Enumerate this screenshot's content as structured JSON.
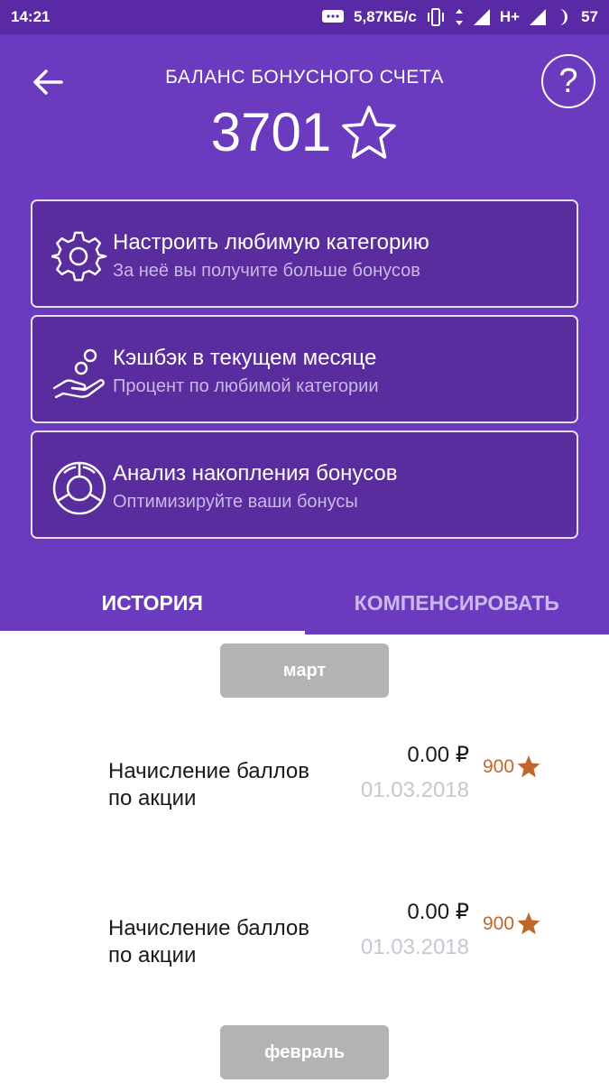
{
  "status_bar": {
    "time": "14:21",
    "speed": "5,87КБ/с",
    "network": "H+",
    "battery": "57",
    "icons": [
      "message-icon",
      "vibrate-icon",
      "data-arrows-icon",
      "signal-icon",
      "signal-icon",
      "moon-icon"
    ]
  },
  "header": {
    "back_icon": "arrow-left-icon",
    "help_label": "?",
    "title": "БАЛАНС БОНУСНОГО СЧЕТА",
    "balance": "3701",
    "balance_icon": "star-outline-icon"
  },
  "cards": [
    {
      "icon": "gear-icon",
      "title": "Настроить любимую категорию",
      "subtitle": "За неё вы получите больше бонусов"
    },
    {
      "icon": "hand-coins-icon",
      "title": "Кэшбэк в текущем месяце",
      "subtitle": "Процент по любимой категории"
    },
    {
      "icon": "pie-segments-icon",
      "title": "Анализ накопления бонусов",
      "subtitle": "Оптимизируйте ваши бонусы"
    }
  ],
  "tabs": [
    {
      "label": "ИСТОРИЯ",
      "active": true
    },
    {
      "label": "КОМПЕНСИРОВАТЬ",
      "active": false
    }
  ],
  "history": {
    "months": [
      "март",
      "февраль"
    ],
    "transactions": [
      {
        "description_line1": "Начисление баллов",
        "description_line2": "по акции",
        "amount": "0.00 ₽",
        "date": "01.03.2018",
        "bonus": "900",
        "bonus_icon": "star-filled-icon"
      },
      {
        "description_line1": "Начисление баллов",
        "description_line2": "по акции",
        "amount": "0.00 ₽",
        "date": "01.03.2018",
        "bonus": "900",
        "bonus_icon": "star-filled-icon"
      }
    ]
  },
  "colors": {
    "status_bar": "#5a2aa6",
    "header": "#6a3bbf",
    "card": "#5a2d9e",
    "bonus": "#c0662b",
    "pill": "#b3b3b3"
  }
}
